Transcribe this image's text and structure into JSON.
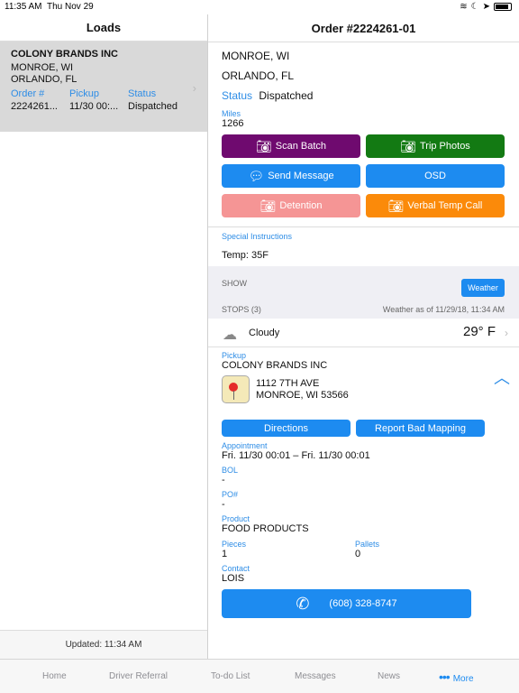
{
  "status_bar": {
    "time": "11:35 AM",
    "date": "Thu Nov 29"
  },
  "loads": {
    "title": "Loads",
    "cards": [
      {
        "name": "COLONY BRANDS INC",
        "origin": "MONROE, WI",
        "destination": "ORLANDO, FL",
        "headers": [
          "Order #",
          "Pickup",
          "Status"
        ],
        "values": [
          "2224261...",
          "11/30 00:...",
          "Dispatched"
        ]
      }
    ],
    "updated": "Updated: 11:34 AM"
  },
  "order": {
    "title": "Order #2224261-01",
    "origin": "MONROE, WI",
    "destination": "ORLANDO, FL",
    "status_label": "Status",
    "status_value": "Dispatched",
    "miles_label": "Miles",
    "miles_value": "1266",
    "buttons": {
      "scan_batch": "Scan Batch",
      "trip_photos": "Trip Photos",
      "send_message": "Send Message",
      "osd": "OSD",
      "detention": "Detention",
      "verbal_temp_call": "Verbal Temp Call"
    },
    "button_colors": {
      "scan_batch": "#6f0a6f",
      "trip_photos": "#137a13",
      "send_message": "#1d8bf0",
      "osd": "#1d8bf0",
      "detention": "#f59595",
      "verbal_temp_call": "#fb8a0a"
    },
    "special_label": "Special Instructions",
    "special_value": "Temp: 35F",
    "show_label": "SHOW",
    "weather_button": "Weather",
    "stops_label": "STOPS (3)",
    "weather_as_of": "Weather as of 11/29/18, 11:34 AM",
    "weather": {
      "condition": "Cloudy",
      "temperature": "29° F",
      "icon": "cloud-icon"
    },
    "stop": {
      "type_label": "Pickup",
      "company": "COLONY BRANDS INC",
      "address_line1": "1112 7TH AVE",
      "address_line2": "MONROE, WI 53566",
      "directions": "Directions",
      "report_bad_mapping": "Report Bad Mapping",
      "appointment_label": "Appointment",
      "appointment_value": "Fri. 11/30 00:01 – Fri. 11/30 00:01",
      "bol_label": "BOL",
      "bol_value": "-",
      "po_label": "PO#",
      "po_value": "-",
      "product_label": "Product",
      "product_value": "FOOD PRODUCTS",
      "pieces_label": "Pieces",
      "pieces_value": "1",
      "pallets_label": "Pallets",
      "pallets_value": "0",
      "contact_label": "Contact",
      "contact_value": "LOIS",
      "phone": "(608) 328-8747"
    }
  },
  "tabs": [
    "Home",
    "Driver Referral",
    "To-do List",
    "Messages",
    "News",
    "More"
  ],
  "accent_color": "#1d8bf0"
}
